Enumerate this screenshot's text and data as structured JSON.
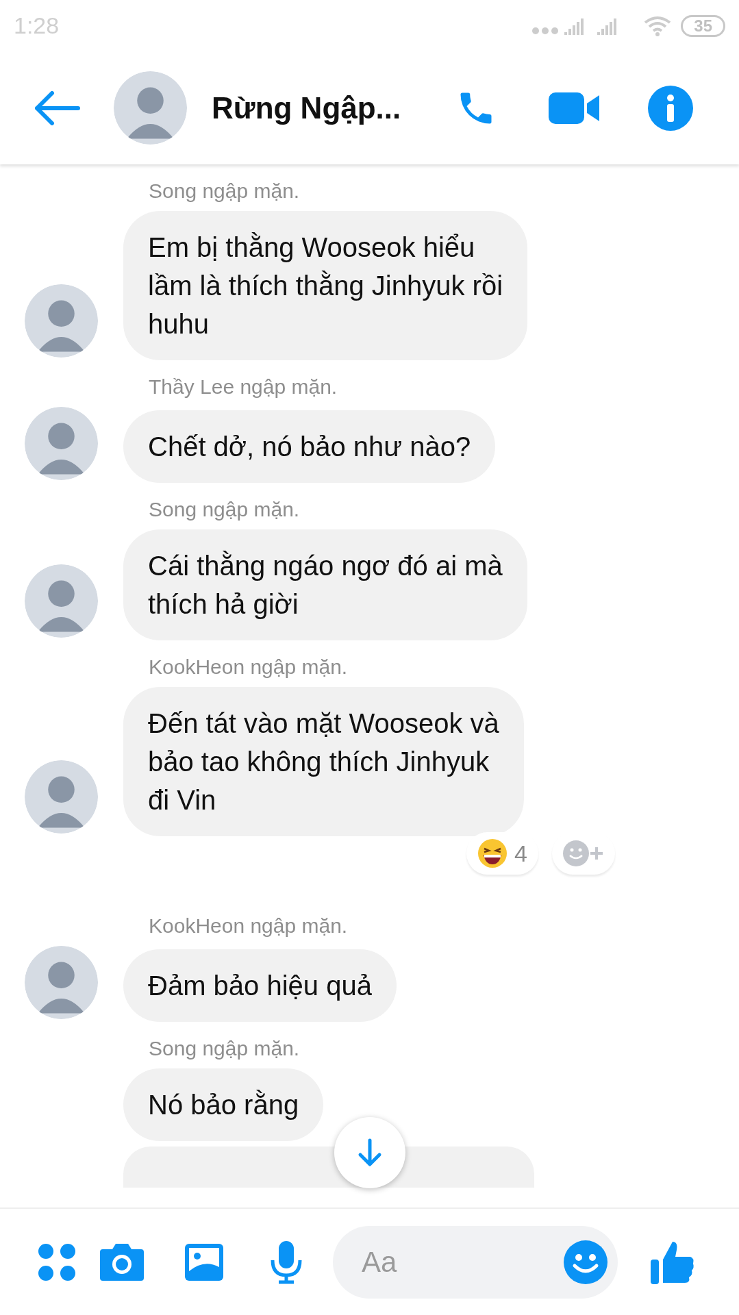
{
  "status_bar": {
    "time": "1:28",
    "battery": "35"
  },
  "header": {
    "title": "Rừng Ngập..."
  },
  "messages": [
    {
      "sender": "Song ngập mặn.",
      "text": "Em bị thằng Wooseok hiểu\nlầm là thích thằng Jinhyuk rồi\nhuhu",
      "avatar": true
    },
    {
      "sender": "Thầy Lee ngập mặn.",
      "text": "Chết dở, nó bảo như nào?",
      "avatar": true
    },
    {
      "sender": "Song ngập mặn.",
      "text": "Cái thằng ngáo ngơ đó ai mà\nthích hả giời",
      "avatar": true
    },
    {
      "sender": "KookHeon ngập mặn.",
      "text": "Đến tát vào mặt Wooseok và\nbảo tao không thích Jinhyuk\nđi Vin",
      "avatar": true,
      "reactions": [
        {
          "count": "4"
        }
      ]
    },
    {
      "sender": "KookHeon ngập mặn.",
      "text": "Đảm bảo hiệu quả",
      "avatar": true
    },
    {
      "sender": "Song ngập mặn.",
      "text": "Nó bảo rằng",
      "avatar": false
    }
  ],
  "composer": {
    "placeholder": "Aa"
  }
}
